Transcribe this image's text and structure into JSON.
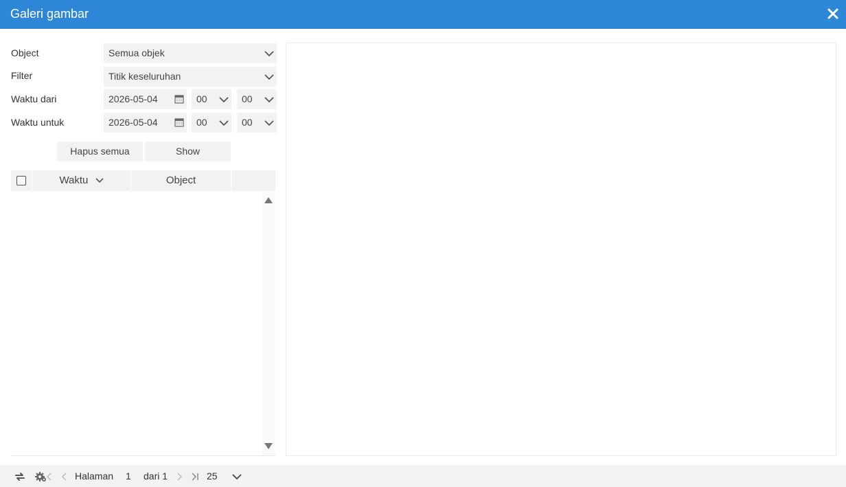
{
  "window": {
    "title": "Galeri gambar",
    "close_icon": "close-icon"
  },
  "form": {
    "object": {
      "label": "Object",
      "value": "Semua objek"
    },
    "filter": {
      "label": "Filter",
      "value": "Titik keseluruhan"
    },
    "time_from": {
      "label": "Waktu dari",
      "date": "2026-05-04",
      "hour": "00",
      "minute": "00"
    },
    "time_to": {
      "label": "Waktu untuk",
      "date": "2026-05-04",
      "hour": "00",
      "minute": "00"
    }
  },
  "buttons": {
    "clear_all": "Hapus semua",
    "show": "Show"
  },
  "table": {
    "columns": [
      {
        "label": "Waktu",
        "sort": "descending"
      },
      {
        "label": "Object"
      }
    ],
    "rows": []
  },
  "pager": {
    "page_label": "Halaman",
    "page": "1",
    "of_label": "dari 1",
    "page_size": "25"
  },
  "colors": {
    "accent": "#2d86d6",
    "panel": "#f2f2f2"
  }
}
